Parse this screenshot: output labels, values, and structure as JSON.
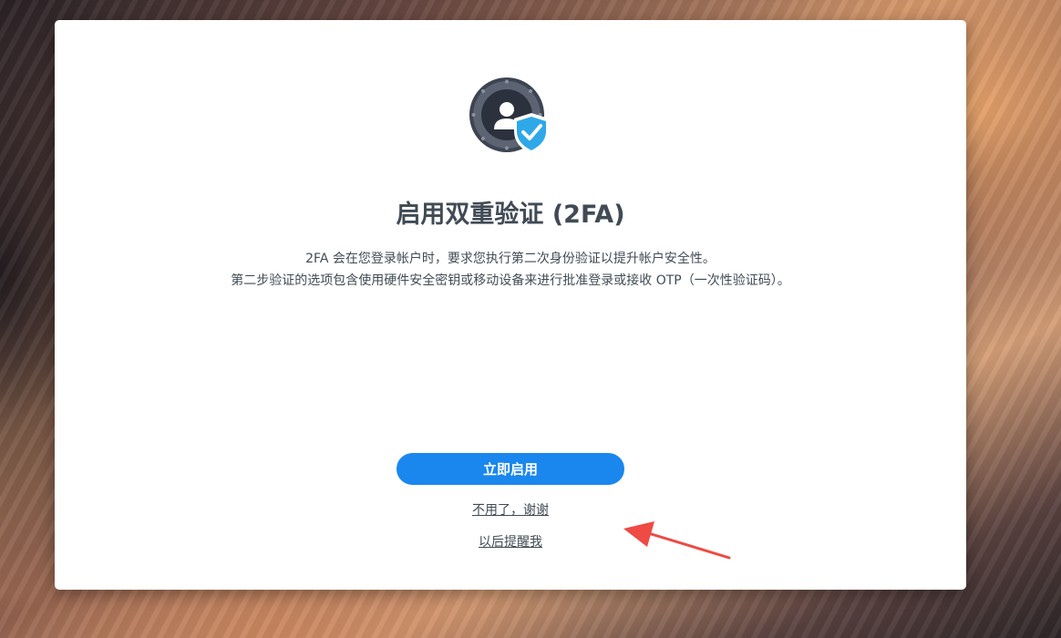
{
  "dialog": {
    "title": "启用双重验证 (2FA)",
    "description_lines": [
      "2FA 会在您登录帐户时，要求您执行第二次身份验证以提升帐户安全性。",
      "第二步验证的选项包含使用硬件安全密钥或移动设备来进行批准登录或接收 OTP（一次性验证码）。"
    ],
    "hero_icon": "account-shield-check-icon",
    "enable_button_label": "立即启用",
    "decline_link_label": "不用了，谢谢",
    "remind_later_link_label": "以后提醒我"
  },
  "annotation": {
    "icon": "red-arrow-icon",
    "color": "#ef4a44"
  },
  "colors": {
    "accent": "#1a87ee",
    "text": "#414b55",
    "shield": "#2fa8e8"
  }
}
